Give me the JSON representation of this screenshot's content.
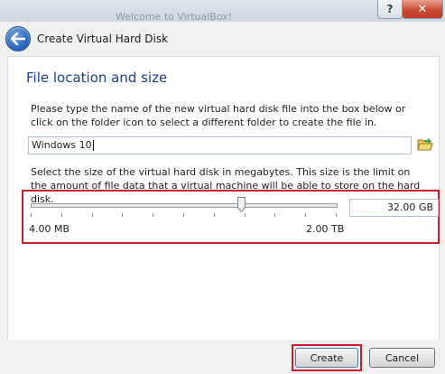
{
  "background_window": {
    "title": "Welcome to VirtualBox!"
  },
  "titlebar": {
    "help_label": "?",
    "close_label": "✕"
  },
  "header": {
    "title": "Create Virtual Hard Disk",
    "back_icon": "back-arrow-icon"
  },
  "section": {
    "title": "File location and size"
  },
  "location": {
    "description": "Please type the name of the new virtual hard disk file into the box below or click on the folder icon to select a different folder to create the file in.",
    "value": "Windows 10",
    "folder_icon": "folder-icon"
  },
  "size": {
    "description": "Select the size of the virtual hard disk in megabytes. This size is the limit on the amount of file data that a virtual machine will be able to store on the hard disk.",
    "value": "32.00 GB",
    "min_label": "4.00 MB",
    "max_label": "2.00 TB",
    "slider_position_fraction": 0.69
  },
  "buttons": {
    "create": "Create",
    "cancel": "Cancel"
  },
  "colors": {
    "highlight": "#c91f2c",
    "section_title": "#1b3f8a"
  }
}
